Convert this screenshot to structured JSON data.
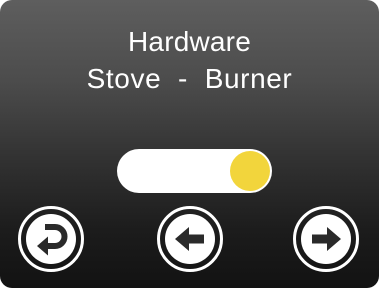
{
  "screen": {
    "title": "Hardware",
    "subtitle": "Stove  -  Burner"
  },
  "toggle": {
    "state": "on",
    "track_color": "#ffffff",
    "knob_color": "#f2d53c"
  },
  "nav": {
    "buttons": [
      {
        "icon": "return-icon"
      },
      {
        "icon": "arrow-left-icon"
      },
      {
        "icon": "arrow-right-icon"
      }
    ]
  }
}
